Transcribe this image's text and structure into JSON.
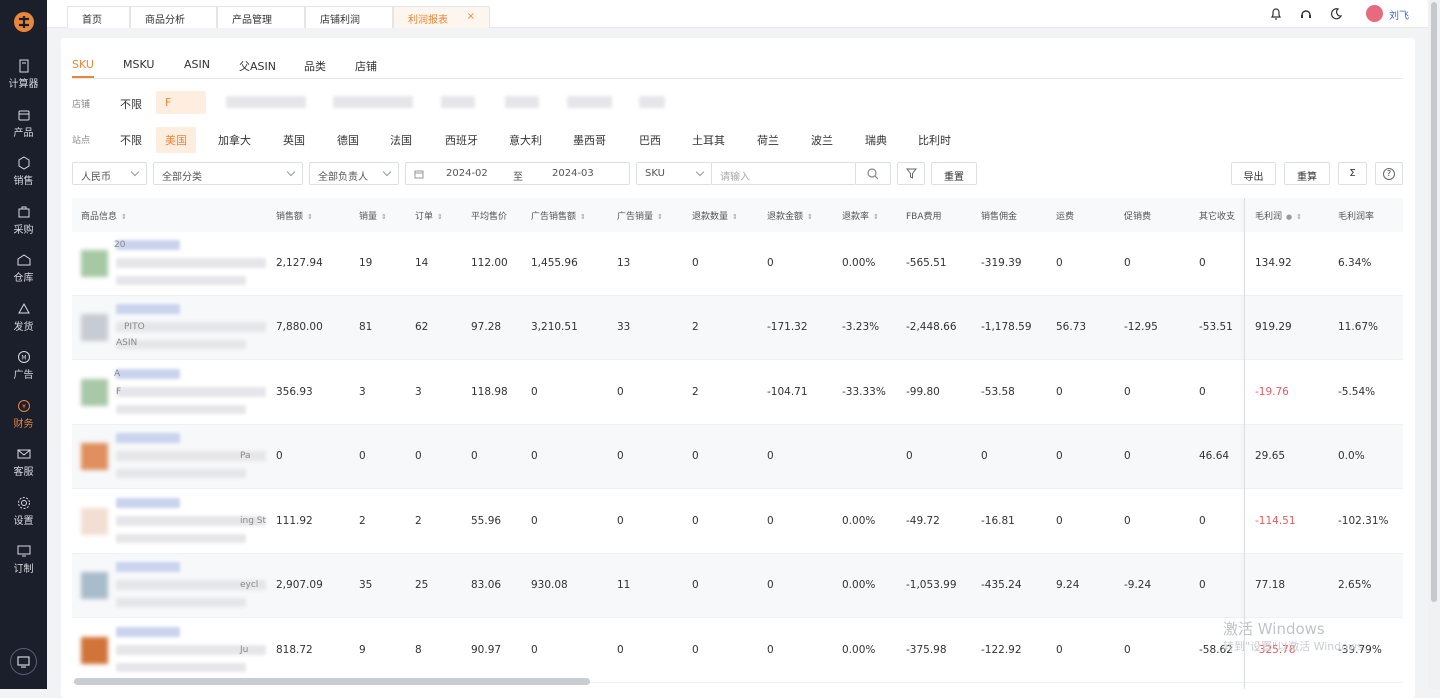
{
  "sidebar": {
    "items": [
      {
        "label": "计算器",
        "icon": "calculator-icon"
      },
      {
        "label": "产品",
        "icon": "box-icon"
      },
      {
        "label": "销售",
        "icon": "sales-icon"
      },
      {
        "label": "采购",
        "icon": "purchase-icon"
      },
      {
        "label": "仓库",
        "icon": "warehouse-icon"
      },
      {
        "label": "发货",
        "icon": "ship-icon"
      },
      {
        "label": "广告",
        "icon": "ad-icon"
      },
      {
        "label": "财务",
        "icon": "finance-icon"
      },
      {
        "label": "客服",
        "icon": "mail-icon"
      },
      {
        "label": "设置",
        "icon": "gear-icon"
      },
      {
        "label": "订制",
        "icon": "monitor-icon"
      }
    ],
    "active": "财务",
    "accent": "#e8863a"
  },
  "tabs": [
    {
      "label": "首页"
    },
    {
      "label": "商品分析"
    },
    {
      "label": "产品管理"
    },
    {
      "label": "店铺利润"
    },
    {
      "label": "利润报表",
      "active": true,
      "close": "×"
    }
  ],
  "header": {
    "user_name": "刘飞"
  },
  "dimension_tabs": [
    "SKU",
    "MSKU",
    "ASIN",
    "父ASIN",
    "品类",
    "店铺"
  ],
  "store_filter": {
    "label": "店铺",
    "options": [
      "不限",
      "F"
    ]
  },
  "site_filter": {
    "label": "站点",
    "options": [
      "不限",
      "美国",
      "加拿大",
      "英国",
      "德国",
      "法国",
      "西班牙",
      "意大利",
      "墨西哥",
      "巴西",
      "土耳其",
      "荷兰",
      "波兰",
      "瑞典",
      "比利时"
    ],
    "active": "美国"
  },
  "toolbar": {
    "currency": "人民币",
    "category": "全部分类",
    "owner": "全部负责人",
    "date_start": "2024-02",
    "date_sep": "至",
    "date_end": "2024-03",
    "search_type": "SKU",
    "search_placeholder": "请输入",
    "reset": "重置",
    "export": "导出",
    "recalc": "重算",
    "sum_icon": "Σ",
    "help_icon": "?"
  },
  "table": {
    "columns": [
      "商品信息",
      "销售额",
      "销量",
      "订单",
      "平均售价",
      "广告销售额",
      "广告销量",
      "退款数量",
      "退款金额",
      "退款率",
      "FBA费用",
      "销售佣金",
      "运费",
      "促销费",
      "其它收支",
      "毛利润",
      "毛利润率"
    ],
    "rows": [
      {
        "frag1": "20",
        "frag2": "",
        "values": [
          "2,127.94",
          "19",
          "14",
          "112.00",
          "1,455.96",
          "13",
          "0",
          "0",
          "0.00%",
          "-565.51",
          "-319.39",
          "0",
          "0",
          "0",
          "134.92",
          "6.34%"
        ]
      },
      {
        "frag1": "PITO",
        "frag2": "ASIN",
        "values": [
          "7,880.00",
          "81",
          "62",
          "97.28",
          "3,210.51",
          "33",
          "2",
          "-171.32",
          "-3.23%",
          "-2,448.66",
          "-1,178.59",
          "56.73",
          "-12.95",
          "-53.51",
          "919.29",
          "11.67%"
        ]
      },
      {
        "frag1": "A",
        "frag2": "F",
        "values": [
          "356.93",
          "3",
          "3",
          "118.98",
          "0",
          "0",
          "2",
          "-104.71",
          "-33.33%",
          "-99.80",
          "-53.58",
          "0",
          "0",
          "0",
          "-19.76",
          "-5.54%"
        ]
      },
      {
        "frag1": "Pa",
        "frag2": "",
        "values": [
          "0",
          "0",
          "0",
          "0",
          "0",
          "0",
          "0",
          "0",
          "",
          "0",
          "0",
          "0",
          "0",
          "46.64",
          "29.65",
          "0.0%"
        ]
      },
      {
        "frag1": "ing St",
        "frag2": "",
        "values": [
          "111.92",
          "2",
          "2",
          "55.96",
          "0",
          "0",
          "0",
          "0",
          "0.00%",
          "-49.72",
          "-16.81",
          "0",
          "0",
          "0",
          "-114.51",
          "-102.31%"
        ]
      },
      {
        "frag1": "eycl",
        "frag2": "",
        "values": [
          "2,907.09",
          "35",
          "25",
          "83.06",
          "930.08",
          "11",
          "0",
          "0",
          "0.00%",
          "-1,053.99",
          "-435.24",
          "9.24",
          "-9.24",
          "0",
          "77.18",
          "2.65%"
        ]
      },
      {
        "frag1": "Ju",
        "frag2": "",
        "values": [
          "818.72",
          "9",
          "8",
          "90.97",
          "0",
          "0",
          "0",
          "0",
          "0.00%",
          "-375.98",
          "-122.92",
          "0",
          "0",
          "-58.62",
          "-325.78",
          "-39.79%"
        ]
      }
    ]
  },
  "watermark": {
    "line1": "激活 Windows",
    "line2": "转到\"设置\"以激活 Windows。"
  }
}
